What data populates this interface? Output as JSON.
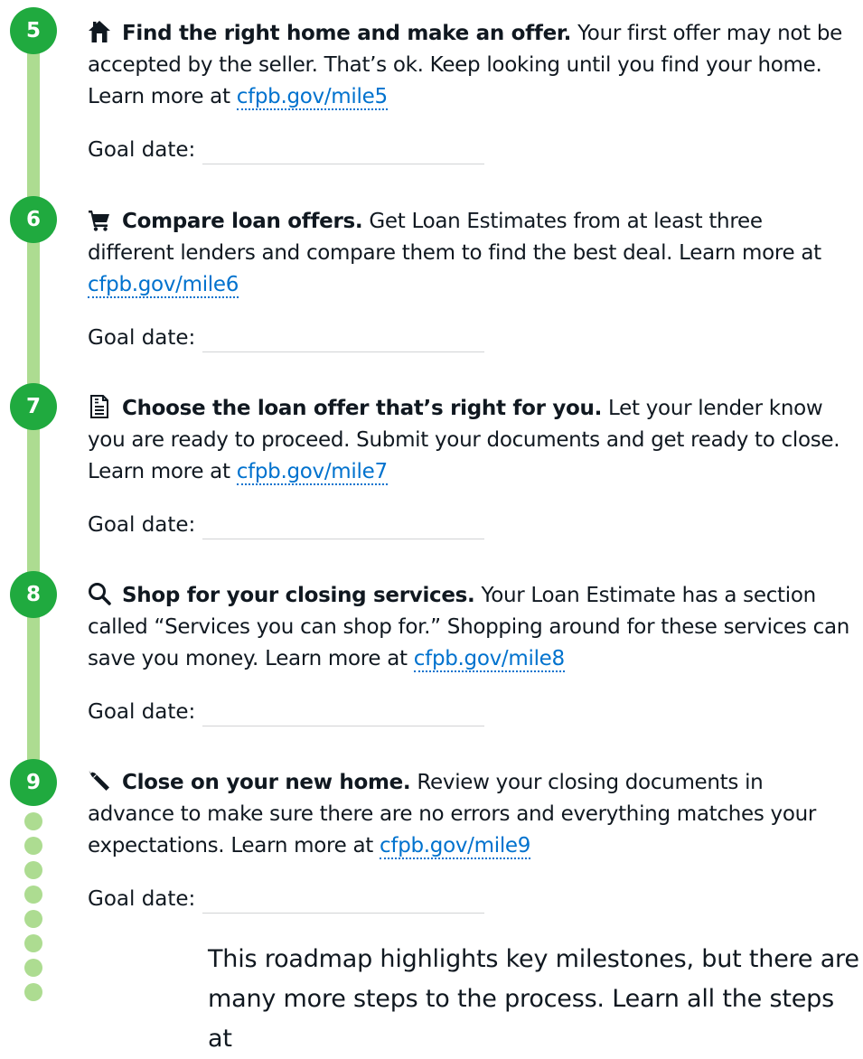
{
  "colors": {
    "accent_green": "#20aa3f",
    "track_green": "#addc91",
    "link_blue": "#0072ce"
  },
  "steps": [
    {
      "number": "5",
      "icon": "house-icon",
      "title": "Find the right home and make an offer.",
      "text": " Your first offer may not be accepted by the seller. That’s ok. Keep looking until you find your home. Learn more at ",
      "link": "cfpb.gov/mile5",
      "goal_label": "Goal date:"
    },
    {
      "number": "6",
      "icon": "cart-icon",
      "title": "Compare loan offers.",
      "text": " Get Loan Estimates from at least three different lenders and compare them to find the best deal. Learn more at ",
      "link": "cfpb.gov/mile6",
      "goal_label": "Goal date:"
    },
    {
      "number": "7",
      "icon": "document-icon",
      "title": "Choose the loan offer that’s right for you.",
      "text": " Let your lender know you are ready to proceed. Submit your documents and get ready to close. Learn more at ",
      "link": "cfpb.gov/mile7",
      "goal_label": "Goal date:"
    },
    {
      "number": "8",
      "icon": "search-icon",
      "title": "Shop for your closing services.",
      "text": " Your Loan Estimate has a section called “Services you can shop for.” Shopping around for these services can save you money. Learn more at ",
      "link": "cfpb.gov/mile8",
      "goal_label": "Goal date:"
    },
    {
      "number": "9",
      "icon": "pencil-icon",
      "title": "Close on your new home.",
      "text": " Review your closing documents in advance to make sure there are no errors and everything matches your expectations. Learn more at ",
      "link": "cfpb.gov/mile9",
      "goal_label": "Goal date:"
    }
  ],
  "footer_note": "This roadmap highlights key milestones, but there are many more steps to the process. Learn all the steps at"
}
